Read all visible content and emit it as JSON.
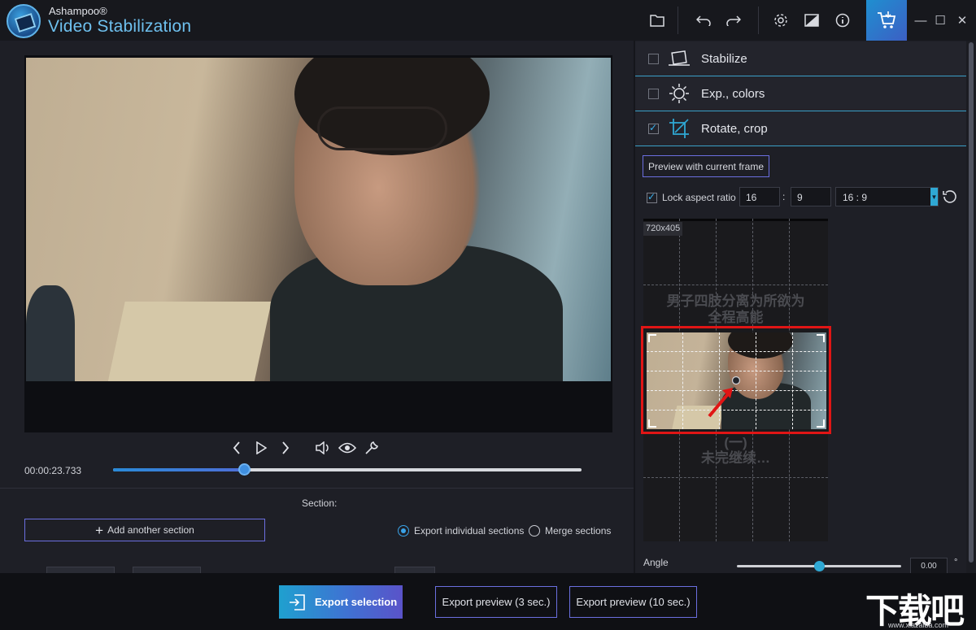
{
  "titlebar": {
    "brand": "Ashampoo®",
    "app_name": "Video Stabilization",
    "icons": [
      "folder-icon",
      "undo-icon",
      "redo-icon",
      "settings-icon",
      "theme-icon",
      "info-icon",
      "cart-icon"
    ],
    "window_controls": [
      "minimize-icon",
      "maximize-icon",
      "close-icon"
    ]
  },
  "player": {
    "timecode": "00:00:23.733",
    "progress": 0.28,
    "controls": [
      "prev-frame-icon",
      "play-icon",
      "next-frame-icon",
      "volume-icon",
      "eye-icon",
      "wrench-icon"
    ]
  },
  "sections": {
    "label": "Section:",
    "add_label": "Add another section",
    "export_individual": "Export individual sections",
    "merge": "Merge sections",
    "selected": "export_individual"
  },
  "panel": {
    "stabilize": {
      "label": "Stabilize",
      "checked": false
    },
    "exposure": {
      "label": "Exp., colors",
      "checked": false
    },
    "rotate": {
      "label": "Rotate, crop",
      "checked": true
    },
    "preview_button": "Preview with current frame",
    "lock_aspect_label": "Lock aspect ratio",
    "ratio_w": "16",
    "ratio_h": "9",
    "ratio_colon": ":",
    "ratio_preset": "16 : 9",
    "crop_dimensions": "720x405",
    "overlay_line1": "男子四肢分离为所欲为",
    "overlay_line2": "全程高能",
    "overlay_line3": "(一)",
    "overlay_line4": "未完继续…",
    "angle_label": "Angle",
    "angle_value": "0.00",
    "angle_unit": "°",
    "angle_position": 0.5
  },
  "export": {
    "main": "Export selection",
    "preview3": "Export preview (3 sec.)",
    "preview10": "Export preview (10 sec.)"
  },
  "watermark": {
    "text": "下载吧",
    "url": "www.xiazaiba.com"
  },
  "colors": {
    "accent": "#2fa8d4",
    "button_border": "#6b6fe0",
    "highlight": "#e01515"
  }
}
